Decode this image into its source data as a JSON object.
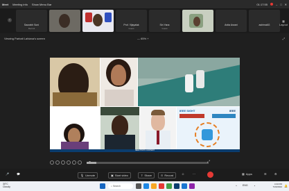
{
  "topbar": {
    "app_label": "Meet",
    "meeting_info": "Meeting info",
    "window_label": "Show Menu Bar",
    "timer": "01:17:55",
    "colors": {
      "record": "#e53935"
    }
  },
  "participants": [
    {
      "name": "Saurabh Soni",
      "sub": "Recruit"
    },
    {
      "name": "",
      "sub": ""
    },
    {
      "name": "",
      "sub": ""
    },
    {
      "name": "Prof. Vijayalak",
      "sub": "Guest"
    },
    {
      "name": "Sin Yana",
      "sub": "Guest"
    },
    {
      "name": "",
      "sub": ""
    },
    {
      "name": "Anita Asrani",
      "sub": ""
    },
    {
      "name": "ashima6G",
      "sub": ""
    }
  ],
  "layout_label": "Layout",
  "viewing": {
    "label": "Viewing Parbati Lahiana's screen",
    "zoom": "65%"
  },
  "share": {
    "ieee_sight": "IEEE SIGHT",
    "ieee": "IEEE",
    "banner": "IEEE PHOTO CONTEST"
  },
  "progress": 0.08,
  "toolbar": {
    "unmute": "Unmute",
    "start_video": "Start video",
    "share": "Share",
    "record": "Record",
    "apps": "Apps",
    "colors": {
      "leave": "#e53935"
    }
  },
  "taskbar": {
    "weather": "30°C",
    "weather_sub": "Cloudy",
    "search": "Search",
    "time": "4:33 PM",
    "date": "7/20/2024",
    "lang": "ENG"
  }
}
